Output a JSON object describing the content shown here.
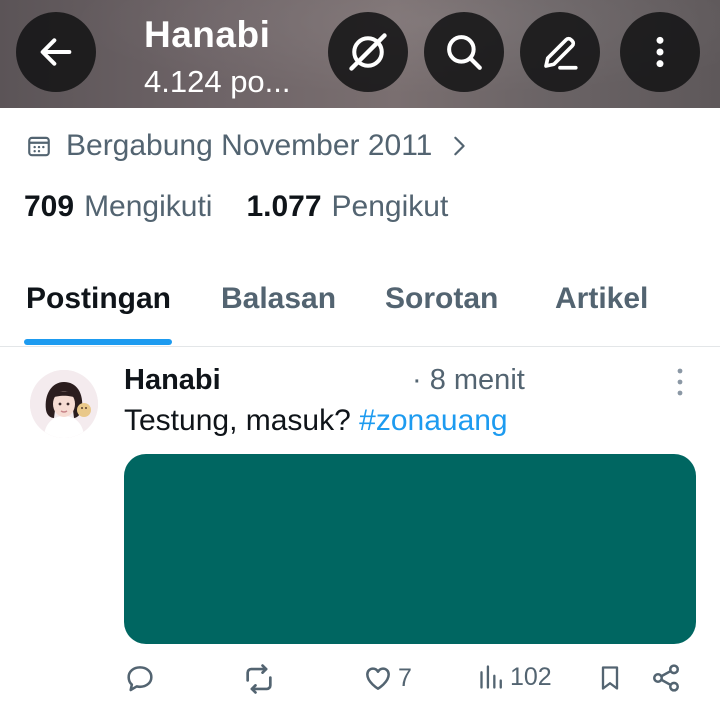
{
  "header": {
    "title": "Hanabi",
    "subtitle": "4.124 po...",
    "icons": [
      "back-arrow-icon",
      "grok-icon",
      "search-icon",
      "edit-icon",
      "more-vertical-icon"
    ]
  },
  "profile": {
    "joined_text": "Bergabung November 2011",
    "following_count": "709",
    "following_label": "Mengikuti",
    "followers_count": "1.077",
    "followers_label": "Pengikut"
  },
  "tabs": [
    {
      "label": "Postingan",
      "active": true
    },
    {
      "label": "Balasan",
      "active": false
    },
    {
      "label": "Sorotan",
      "active": false
    },
    {
      "label": "Artikel",
      "active": false
    }
  ],
  "post": {
    "author": "Hanabi",
    "time": "· 8 menit",
    "text": "Testung, masuk?",
    "hashtag": "#zonauang",
    "media_color": "#006661",
    "likes": "7",
    "views": "102"
  },
  "colors": {
    "accent": "#1d9bf0",
    "secondary_text": "#536471",
    "primary_text": "#0f1419"
  }
}
